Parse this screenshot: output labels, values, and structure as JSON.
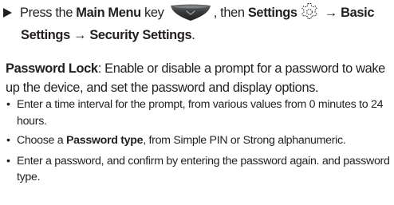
{
  "step": {
    "arrow_glyph": "▶",
    "text_press": "Press the ",
    "main_menu_key": "Main Menu",
    "text_key_then": " key ",
    "text_comma_then": ", then ",
    "settings": "Settings",
    "arrow1": " → ",
    "basic_settings": "Basic Settings",
    "arrow2": " → ",
    "security_settings": "Security Settings",
    "end": "."
  },
  "password_lock": {
    "title": "Password Lock",
    "description": ": Enable or disable a prompt for a password to wake up the device, and set the password and display options."
  },
  "bullets": {
    "dot": "•",
    "item1": "Enter a time interval for the prompt, from various values from 0 minutes to 24 hours.",
    "item2_pre": "Choose a ",
    "item2_bold": "Password type",
    "item2_post": ", from Simple PIN or Strong alphanumeric.",
    "item3": " Enter a password, and confirm by entering the password again. and password type."
  },
  "icons": {
    "main_menu_key": "main-menu-key-icon",
    "settings": "gear-icon"
  }
}
